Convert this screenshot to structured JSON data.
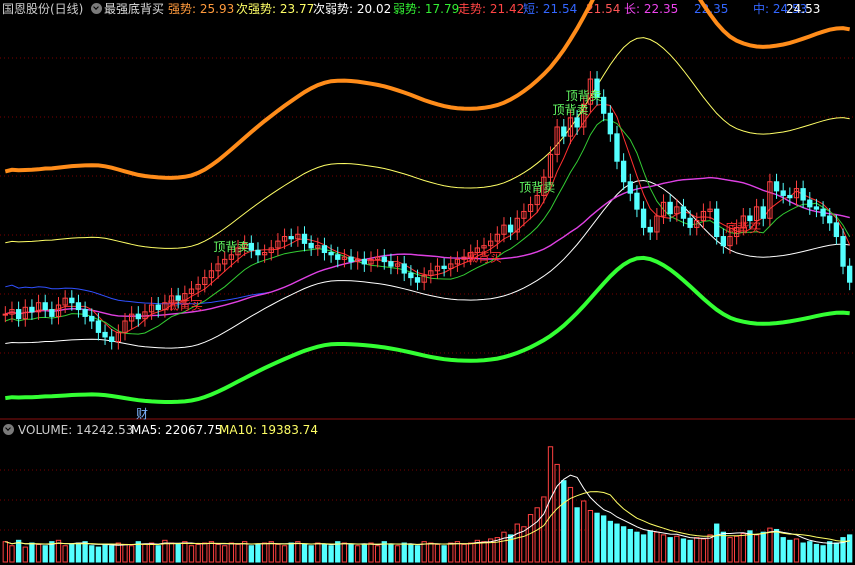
{
  "header": {
    "stock": "国恩股份(日线)",
    "indicator": "最强底背买",
    "items": [
      {
        "label": "强势: ",
        "value": "25.93",
        "color": "#ff9a3c"
      },
      {
        "label": "次强势: ",
        "value": "23.77",
        "color": "#ffff66"
      },
      {
        "label": "次弱势: ",
        "value": "20.02",
        "color": "#ffffff"
      },
      {
        "label": "弱势: ",
        "value": "17.79",
        "color": "#33ee33"
      },
      {
        "label": "走势: ",
        "value": "21.42",
        "color": "#ff4444"
      },
      {
        "label": "短: ",
        "value": "21.54",
        "color": "#3366ff"
      },
      {
        "label": "",
        "value": "21.54",
        "color": "#ff5555"
      },
      {
        "label": "长: ",
        "value": "22.35",
        "color": "#ee44ee"
      },
      {
        "label": "",
        "value": "22.35",
        "color": "#3366ff"
      },
      {
        "label": "中: ",
        "value": "24.53",
        "color": "#3366ff"
      },
      {
        "label": "",
        "value": "24.53",
        "color": "#ffffff"
      }
    ]
  },
  "volume_header": {
    "label": "VOLUME: 14242.53",
    "ma5": "MA5: 22067.75",
    "ma10": "MA10: 19383.74"
  },
  "finance_marker": "财",
  "colors": {
    "up": "#ff4040",
    "down": "#54ffff",
    "strong": "#ff8c1a",
    "second_strong": "#ffff66",
    "second_weak": "#ffffff",
    "weak": "#33ff33",
    "trend": "#ff3030",
    "long": "#e040e0",
    "mid": "#3050ff",
    "ma5": "#ffffff",
    "ma10": "#ffff66"
  },
  "chart_data": {
    "type": "candlestick",
    "signals": [
      {
        "text": "顶背卖",
        "index": 34,
        "kind": "sell"
      },
      {
        "text": "底背买",
        "index": 27,
        "kind": "buy"
      },
      {
        "text": "底背买",
        "index": 72,
        "kind": "buy"
      },
      {
        "text": "顶背卖",
        "index": 80,
        "kind": "sell"
      },
      {
        "text": "顶背卖",
        "index": 85,
        "kind": "sell"
      },
      {
        "text": "顶背卖",
        "index": 87,
        "kind": "sell"
      },
      {
        "text": "底背买",
        "index": 111,
        "kind": "buy"
      }
    ],
    "close": [
      18.4,
      18.6,
      18.2,
      18.7,
      18.5,
      18.9,
      18.6,
      18.3,
      18.8,
      19.1,
      18.9,
      18.6,
      18.3,
      18.1,
      17.6,
      17.4,
      17.2,
      17.6,
      18.1,
      18.4,
      18.2,
      18.5,
      18.8,
      18.6,
      18.9,
      19.2,
      19.0,
      19.3,
      19.5,
      19.7,
      20.0,
      20.3,
      20.6,
      20.8,
      21.0,
      21.3,
      21.5,
      21.2,
      21.0,
      21.1,
      21.3,
      21.6,
      21.8,
      21.7,
      21.9,
      21.5,
      21.3,
      21.4,
      21.1,
      21.0,
      20.8,
      20.9,
      20.7,
      20.8,
      20.6,
      20.8,
      20.9,
      20.7,
      20.5,
      20.6,
      20.2,
      20.0,
      19.8,
      20.1,
      20.3,
      20.5,
      20.4,
      20.6,
      20.8,
      20.9,
      21.1,
      21.3,
      21.4,
      21.6,
      21.9,
      22.3,
      22.0,
      22.6,
      22.9,
      23.2,
      23.6,
      24.4,
      25.4,
      26.6,
      26.2,
      27.0,
      26.6,
      27.6,
      28.7,
      27.9,
      27.2,
      26.3,
      25.1,
      24.2,
      23.7,
      23.0,
      22.2,
      22.0,
      22.7,
      23.3,
      22.8,
      23.1,
      22.6,
      22.2,
      22.5,
      22.9,
      23.0,
      21.8,
      21.4,
      21.8,
      22.2,
      22.7,
      22.5,
      23.1,
      22.6,
      24.2,
      23.8,
      23.6,
      23.5,
      23.9,
      23.4,
      23.1,
      23.0,
      22.7,
      22.4,
      21.8,
      20.5,
      19.8
    ],
    "volume": [
      15,
      12,
      16,
      11,
      14,
      13,
      12,
      15,
      16,
      12,
      13,
      14,
      15,
      12,
      11,
      13,
      12,
      14,
      13,
      12,
      15,
      13,
      14,
      12,
      16,
      14,
      13,
      15,
      12,
      13,
      14,
      15,
      13,
      12,
      14,
      13,
      15,
      12,
      13,
      14,
      15,
      13,
      12,
      14,
      15,
      13,
      12,
      14,
      13,
      12,
      15,
      14,
      13,
      12,
      13,
      14,
      12,
      15,
      13,
      12,
      14,
      13,
      12,
      15,
      14,
      13,
      12,
      14,
      15,
      13,
      14,
      16,
      15,
      17,
      18,
      22,
      20,
      28,
      26,
      35,
      40,
      48,
      85,
      72,
      60,
      55,
      40,
      45,
      38,
      36,
      34,
      30,
      28,
      26,
      24,
      22,
      20,
      23,
      22,
      20,
      18,
      19,
      17,
      16,
      18,
      17,
      20,
      28,
      22,
      18,
      19,
      21,
      23,
      20,
      22,
      25,
      24,
      18,
      16,
      17,
      14,
      15,
      13,
      12,
      15,
      14,
      18,
      20
    ]
  }
}
